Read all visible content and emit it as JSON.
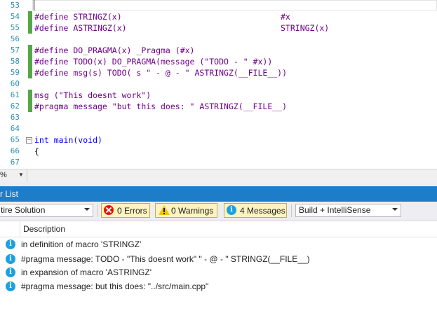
{
  "editor": {
    "lines": [
      {
        "num": "53",
        "code": ""
      },
      {
        "num": "54",
        "code": "#define STRINGZ(x)",
        "col2": "#x"
      },
      {
        "num": "55",
        "code": "#define ASTRINGZ(x)",
        "col2": "STRINGZ(x)"
      },
      {
        "num": "56",
        "code": ""
      },
      {
        "num": "57",
        "code": "#define DO_PRAGMA(x) _Pragma (#x)"
      },
      {
        "num": "58",
        "code": "#define TODO(x) DO_PRAGMA(message (\"TODO - \" #x))"
      },
      {
        "num": "59",
        "code": "#define msg(s) TODO( s \" - @ - \" ASTRINGZ(__FILE__))"
      },
      {
        "num": "60",
        "code": ""
      },
      {
        "num": "61",
        "code": "msg (\"This doesnt work\")"
      },
      {
        "num": "62",
        "code": "#pragma message \"but this does: \" ASTRINGZ(__FILE__)"
      },
      {
        "num": "63",
        "code": ""
      },
      {
        "num": "64",
        "code": ""
      },
      {
        "num": "65",
        "code": "int main(void)"
      },
      {
        "num": "66",
        "code": "{"
      },
      {
        "num": "67",
        "code": ""
      }
    ],
    "zoom": "%"
  },
  "error_list": {
    "title": "r List",
    "scope": "tire Solution",
    "errors": "0 Errors",
    "warnings": "0 Warnings",
    "messages": "4 Messages",
    "build_filter": "Build + IntelliSense",
    "column_description": "Description",
    "items": [
      "in definition of macro 'STRINGZ'",
      "#pragma message: TODO - \"This doesnt work\" \" - @ - \" STRINGZ(__FILE__)",
      "in expansion of macro 'ASTRINGZ'",
      "#pragma message: but this does: \"../src/main.cpp\""
    ]
  },
  "colors": {
    "title_bar": "#1e7dc9",
    "info_icon": "#1ba1e2",
    "error_icon": "#e51400",
    "warning_icon": "#f3c117",
    "change_marker": "#57a64a"
  }
}
